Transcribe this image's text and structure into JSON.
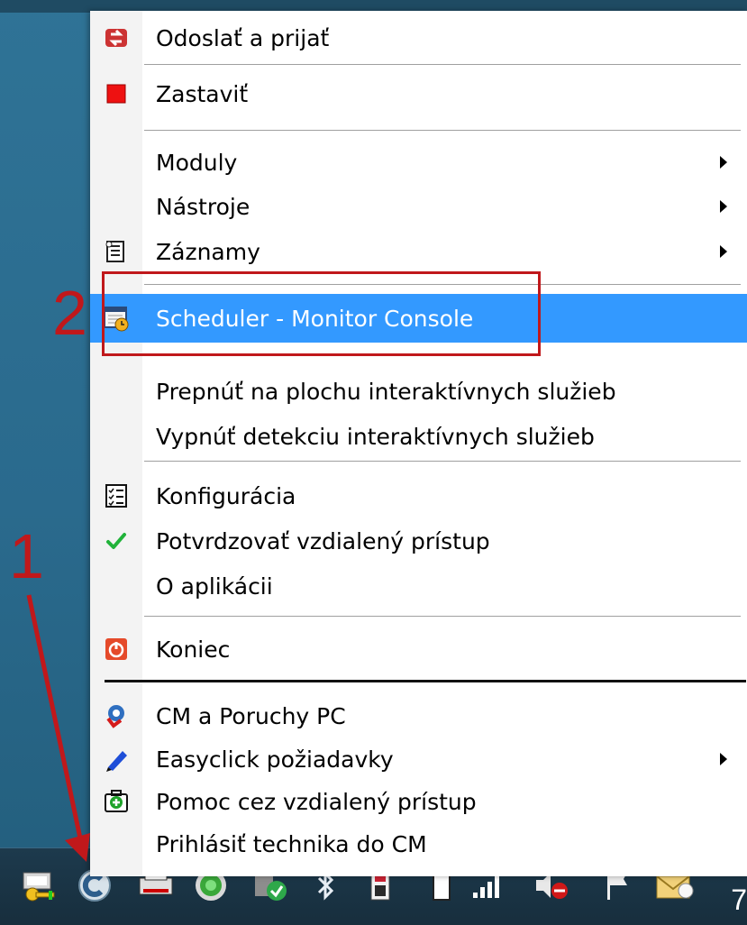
{
  "menu": {
    "items": [
      {
        "label": "Odoslať a prijať",
        "icon": "send-receive-icon",
        "submenu": false
      },
      {
        "label": "Zastaviť",
        "icon": "stop-icon",
        "submenu": false
      },
      {
        "label": "Moduly",
        "icon": "",
        "submenu": true
      },
      {
        "label": "Nástroje",
        "icon": "",
        "submenu": true
      },
      {
        "label": "Záznamy",
        "icon": "records-icon",
        "submenu": true
      },
      {
        "label": "Scheduler - Monitor Console",
        "icon": "scheduler-icon",
        "submenu": false,
        "highlighted": true
      },
      {
        "label": "Prepnúť na plochu interaktívnych služieb",
        "icon": "",
        "submenu": false
      },
      {
        "label": "Vypnúť detekciu interaktívnych služieb",
        "icon": "",
        "submenu": false
      },
      {
        "label": "Konfigurácia",
        "icon": "checklist-icon",
        "submenu": false
      },
      {
        "label": "Potvrdzovať vzdialený prístup",
        "icon": "check-icon",
        "submenu": false
      },
      {
        "label": "O aplikácii",
        "icon": "",
        "submenu": false
      },
      {
        "label": "Koniec",
        "icon": "power-icon",
        "submenu": false
      },
      {
        "label": "CM a Poruchy PC",
        "icon": "cm-icon",
        "submenu": false
      },
      {
        "label": "Easyclick požiadavky",
        "icon": "pen-icon",
        "submenu": true
      },
      {
        "label": "Pomoc cez vzdialený prístup",
        "icon": "first-aid-icon",
        "submenu": false
      },
      {
        "label": "Prihlásiť technika do CM",
        "icon": "",
        "submenu": false
      }
    ]
  },
  "annotations": {
    "one": "1",
    "two": "2"
  },
  "taskbar": {
    "clock": "7",
    "tray_icons": [
      "key-app-icon",
      "c-app-icon",
      "printer-icon",
      "green-circle-icon",
      "shield-check-icon",
      "bluetooth-icon",
      "device-icon",
      "battery-icon",
      "signal-icon",
      "volume-muted-icon",
      "flag-icon",
      "mail-icon"
    ]
  },
  "colors": {
    "highlight": "#3399ff",
    "annotation_red": "#c0181b"
  }
}
